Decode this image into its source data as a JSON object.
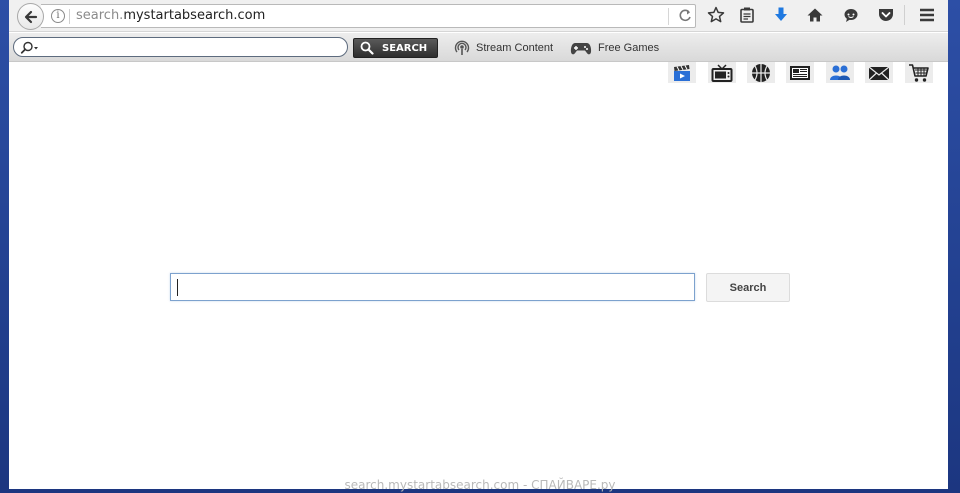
{
  "browser": {
    "url_host_prefix": "search.",
    "url_host_main": "mystartabsearch.com",
    "icons": {
      "back": "back-arrow-icon",
      "info": "i",
      "reload": "reload-icon",
      "bookmark": "star-icon",
      "reading_list": "clipboard-icon",
      "downloads": "download-arrow-icon",
      "home": "home-icon",
      "chat": "chat-icon",
      "pocket": "pocket-icon",
      "menu": "hamburger-menu-icon"
    },
    "accent_color": "#1f79e0"
  },
  "toolbar": {
    "search_placeholder": "",
    "search_button": "SEARCH",
    "stream_content": "Stream Content",
    "free_games": "Free Games"
  },
  "categories": [
    "movies-icon",
    "tv-icon",
    "basketball-icon",
    "news-icon",
    "people-icon",
    "mail-icon",
    "cart-icon"
  ],
  "main": {
    "search_value": "",
    "search_button": "Search"
  },
  "watermark": "search.mystartabsearch.com - СПАЙВАРЕ.ру"
}
